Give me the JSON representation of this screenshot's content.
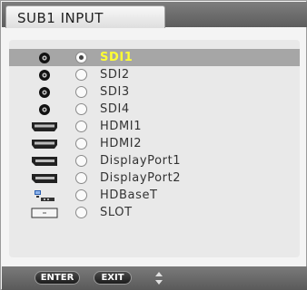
{
  "window": {
    "title": "SUB1 INPUT"
  },
  "inputs": [
    {
      "label": "SDI1",
      "icon": "sdi-connector-icon",
      "selected": true,
      "checked": true
    },
    {
      "label": "SDI2",
      "icon": "sdi-connector-icon",
      "selected": false,
      "checked": false
    },
    {
      "label": "SDI3",
      "icon": "sdi-connector-icon",
      "selected": false,
      "checked": false
    },
    {
      "label": "SDI4",
      "icon": "sdi-connector-icon",
      "selected": false,
      "checked": false
    },
    {
      "label": "HDMI1",
      "icon": "hdmi-connector-icon",
      "selected": false,
      "checked": false
    },
    {
      "label": "HDMI2",
      "icon": "hdmi-connector-icon",
      "selected": false,
      "checked": false
    },
    {
      "label": "DisplayPort1",
      "icon": "displayport-connector-icon",
      "selected": false,
      "checked": false
    },
    {
      "label": "DisplayPort2",
      "icon": "displayport-connector-icon",
      "selected": false,
      "checked": false
    },
    {
      "label": "HDBaseT",
      "icon": "network-connector-icon",
      "selected": false,
      "checked": false
    },
    {
      "label": "SLOT",
      "icon": "slot-icon",
      "selected": false,
      "checked": false
    }
  ],
  "footer": {
    "enter_label": "ENTER",
    "exit_label": "EXIT",
    "nav_icon": "up-down-arrows-icon"
  },
  "colors": {
    "selected_text": "#ffff33",
    "selected_row": "#a6a6a6",
    "bars": "#6a6a6a"
  }
}
